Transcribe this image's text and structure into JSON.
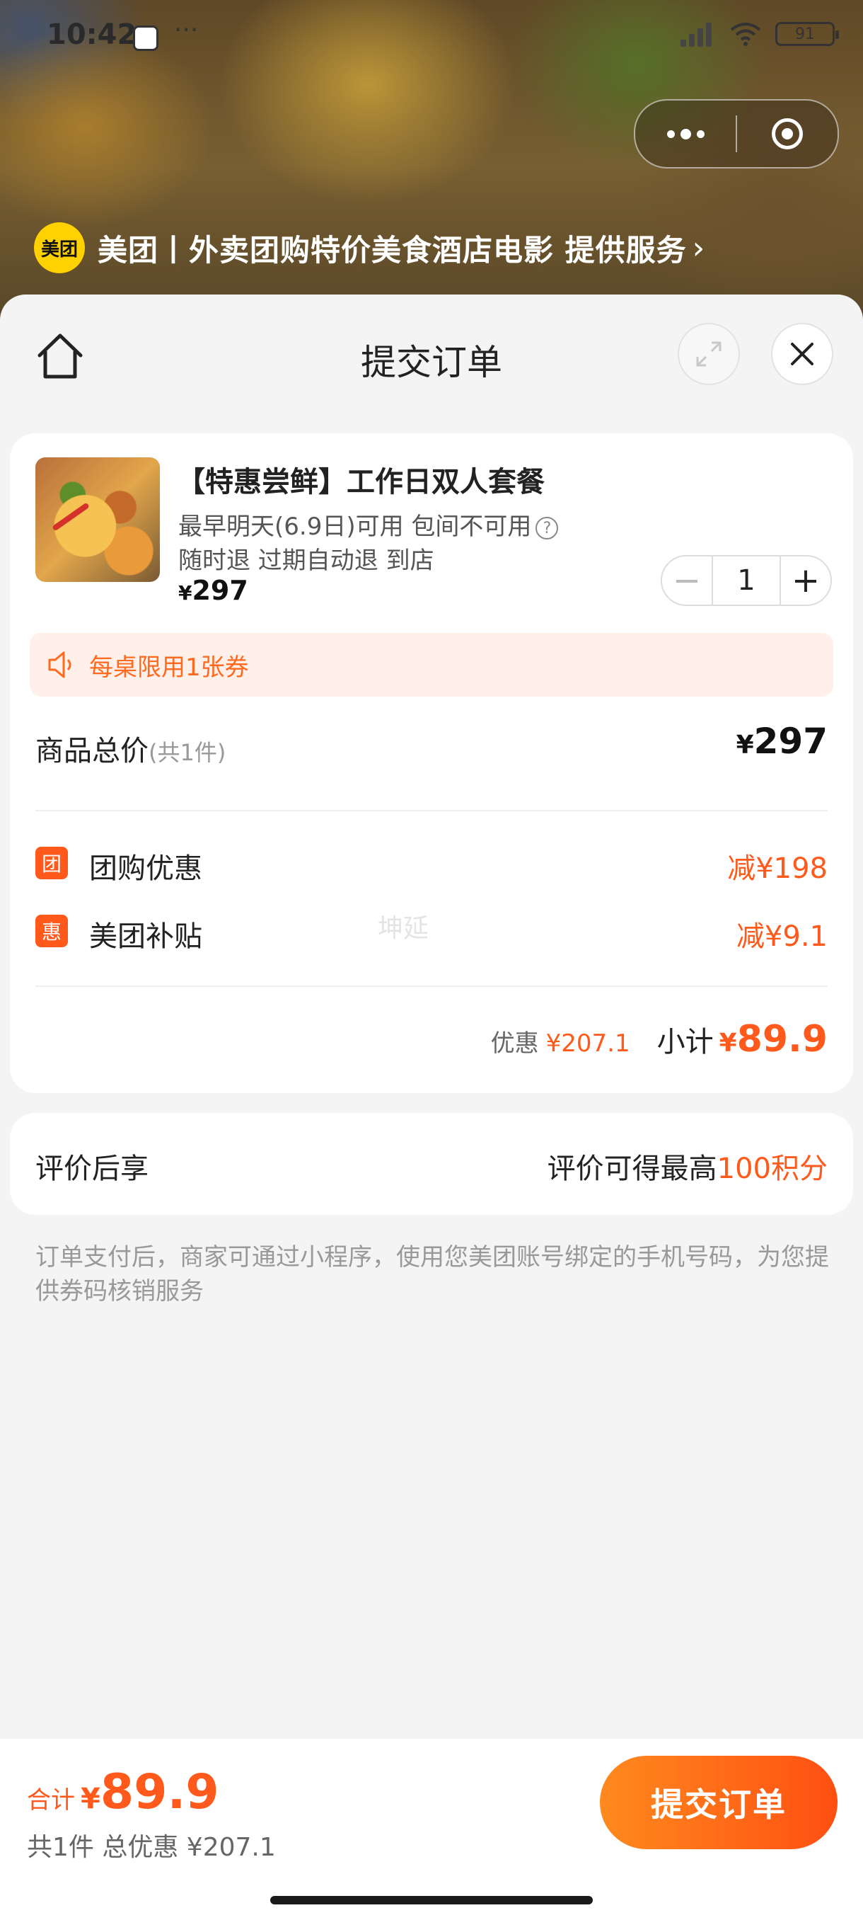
{
  "status_bar": {
    "time": "10:42",
    "extra": "···",
    "battery": "91"
  },
  "provider": {
    "logo_text": "美团",
    "text": "美团丨外卖团购特价美食酒店电影 提供服务"
  },
  "header": {
    "title": "提交订单"
  },
  "product": {
    "name": "【特惠尝鲜】工作日双人套餐",
    "line1": "最早明天(6.9日)可用 包间不可用",
    "line2": "随时退 过期自动退 到店",
    "price_yen": "¥",
    "price": "297",
    "quantity": "1"
  },
  "notice": {
    "text": "每桌限用1张券"
  },
  "totals": {
    "label": "商品总价",
    "count": "(共1件)",
    "value_yen": "¥",
    "value": "297"
  },
  "discounts": [
    {
      "badge": "团",
      "label": "团购优惠",
      "value": "减¥198"
    },
    {
      "badge": "惠",
      "label": "美团补贴",
      "value": "减¥9.1"
    }
  ],
  "watermark": "坤延",
  "subtotal": {
    "discount_label": "优惠",
    "discount_value": "¥207.1",
    "label": "小计",
    "yen": "¥",
    "value": "89.9"
  },
  "review": {
    "label": "评价后享",
    "right_prefix": "评价可得最高",
    "right_highlight": "100积分"
  },
  "footnote": "订单支付后，商家可通过小程序，使用您美团账号绑定的手机号码，为您提供券码核销服务",
  "bottom": {
    "sum_label": "合计",
    "sum_yen": "¥",
    "sum_value": "89.9",
    "sub_text": "共1件 总优惠 ¥207.1",
    "submit_label": "提交订单"
  },
  "colors": {
    "accent": "#ff5a1c",
    "brand_yellow": "#ffd100"
  },
  "icons": [
    "home-icon",
    "expand-icon",
    "close-icon",
    "info-icon",
    "speaker-icon",
    "minus-icon",
    "plus-icon",
    "more-icon",
    "target-icon",
    "chevron-right-icon"
  ]
}
